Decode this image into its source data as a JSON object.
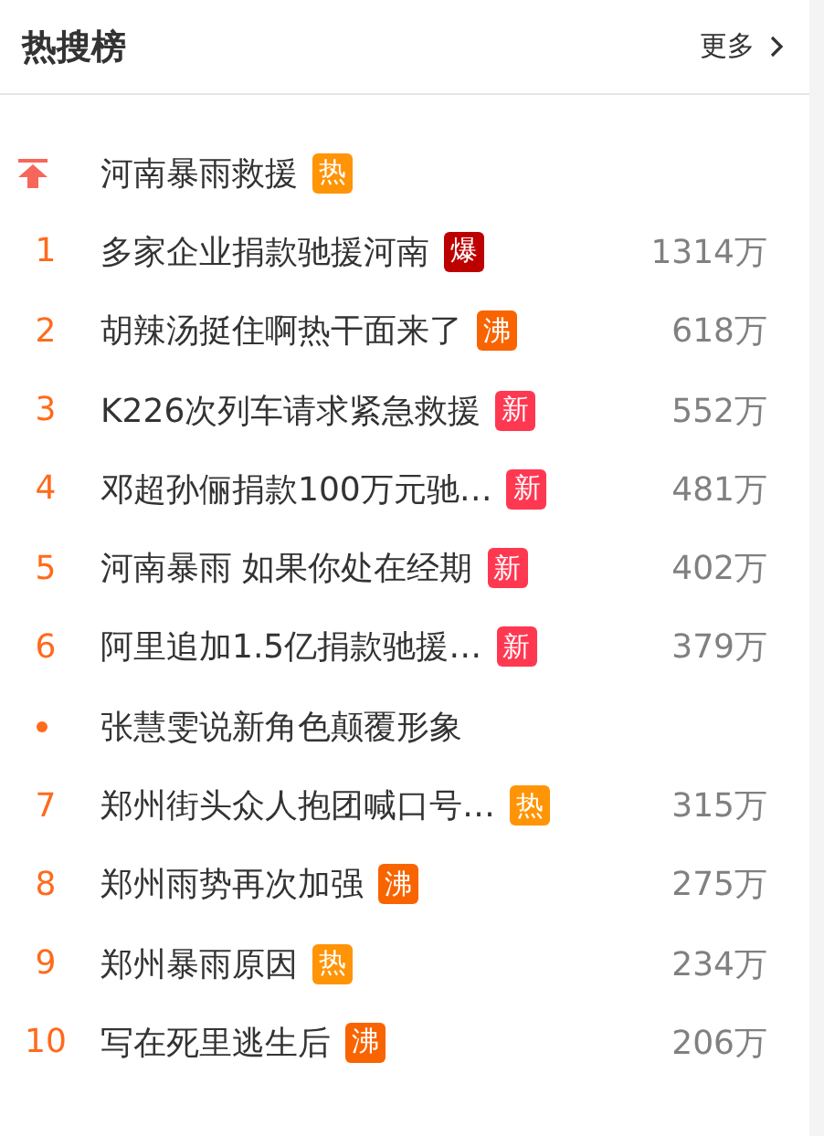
{
  "header": {
    "title": "热搜榜",
    "more": "更多"
  },
  "items": [
    {
      "kind": "pinned",
      "title": "河南暴雨救援",
      "badge": {
        "kind": "hot",
        "text": "热"
      }
    },
    {
      "kind": "ranked",
      "rank": "1",
      "title": "多家企业捐款驰援河南",
      "badge": {
        "kind": "burst",
        "text": "爆"
      },
      "count": "1314万"
    },
    {
      "kind": "ranked",
      "rank": "2",
      "title": "胡辣汤挺住啊热干面来了",
      "badge": {
        "kind": "boil",
        "text": "沸"
      },
      "count": "618万"
    },
    {
      "kind": "ranked",
      "rank": "3",
      "title": "K226次列车请求紧急救援",
      "badge": {
        "kind": "new",
        "text": "新"
      },
      "count": "552万"
    },
    {
      "kind": "ranked",
      "rank": "4",
      "title": "邓超孙俪捐款100万元驰…",
      "badge": {
        "kind": "new",
        "text": "新"
      },
      "count": "481万"
    },
    {
      "kind": "ranked",
      "rank": "5",
      "title": "河南暴雨 如果你处在经期",
      "badge": {
        "kind": "new",
        "text": "新"
      },
      "count": "402万"
    },
    {
      "kind": "ranked",
      "rank": "6",
      "title": "阿里追加1.5亿捐款驰援…",
      "badge": {
        "kind": "new",
        "text": "新"
      },
      "count": "379万"
    },
    {
      "kind": "promo",
      "title": "张慧雯说新角色颠覆形象"
    },
    {
      "kind": "ranked",
      "rank": "7",
      "title": "郑州街头众人抱团喊口号…",
      "badge": {
        "kind": "hot",
        "text": "热"
      },
      "count": "315万"
    },
    {
      "kind": "ranked",
      "rank": "8",
      "title": "郑州雨势再次加强",
      "badge": {
        "kind": "boil",
        "text": "沸"
      },
      "count": "275万"
    },
    {
      "kind": "ranked",
      "rank": "9",
      "title": "郑州暴雨原因",
      "badge": {
        "kind": "hot",
        "text": "热"
      },
      "count": "234万"
    },
    {
      "kind": "ranked",
      "rank": "10",
      "title": "写在死里逃生后",
      "badge": {
        "kind": "boil",
        "text": "沸"
      },
      "count": "206万"
    }
  ]
}
